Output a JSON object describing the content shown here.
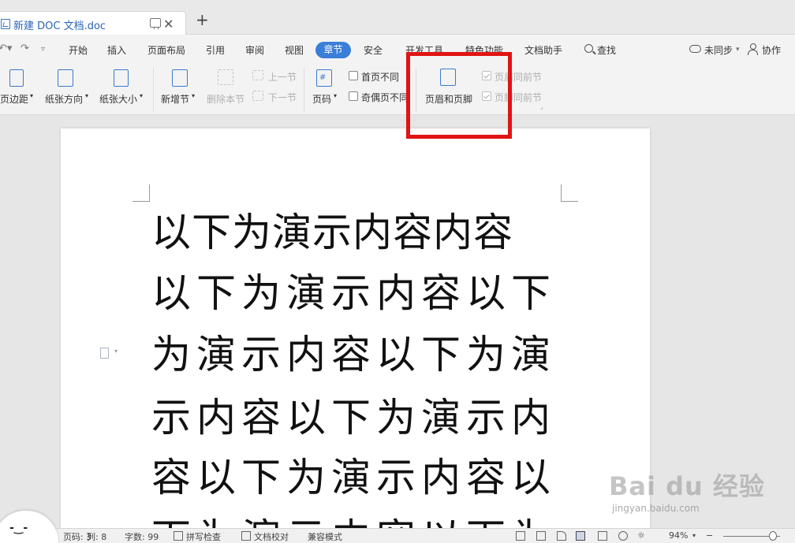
{
  "tab": {
    "title": "新建 DOC 文档.doc"
  },
  "menu": {
    "items": [
      "开始",
      "插入",
      "页面布局",
      "引用",
      "审阅",
      "视图",
      "章节",
      "安全",
      "开发工具",
      "特色功能",
      "文档助手",
      "查找"
    ],
    "active": "章节",
    "sync_label": "未同步",
    "collab_label": "协作"
  },
  "ribbon": {
    "margins": "页边距",
    "orientation": "纸张方向",
    "size": "纸张大小",
    "new_section": "新增节",
    "delete_section": "删除本节",
    "prev_section": "上一节",
    "next_section": "下一节",
    "page_number": "页码",
    "first_page_diff": "首页不同",
    "odd_even_diff": "奇偶页不同",
    "header_footer": "页眉和页脚",
    "header_same_prev": "页眉同前节",
    "footer_same_prev": "页脚同前节"
  },
  "document": {
    "lines": [
      "以下为演示内容内容",
      "以下为演示内容以下",
      "为演示内容以下为演",
      "示内容以下为演示内",
      "容以下为演示内容以",
      "下为演示内容以下为"
    ]
  },
  "status": {
    "page": "页码: 3",
    "column": "列: 8",
    "word_count": "字数: 99",
    "spell_check": "拼写检查",
    "doc_proof": "文档校对",
    "compat_mode": "兼容模式",
    "zoom": "94%"
  },
  "watermark": {
    "main": "Bai du 经验",
    "sub": "jingyan.baidu.com"
  },
  "colors": {
    "accent": "#3a7ed8",
    "highlight": "#e01414"
  }
}
